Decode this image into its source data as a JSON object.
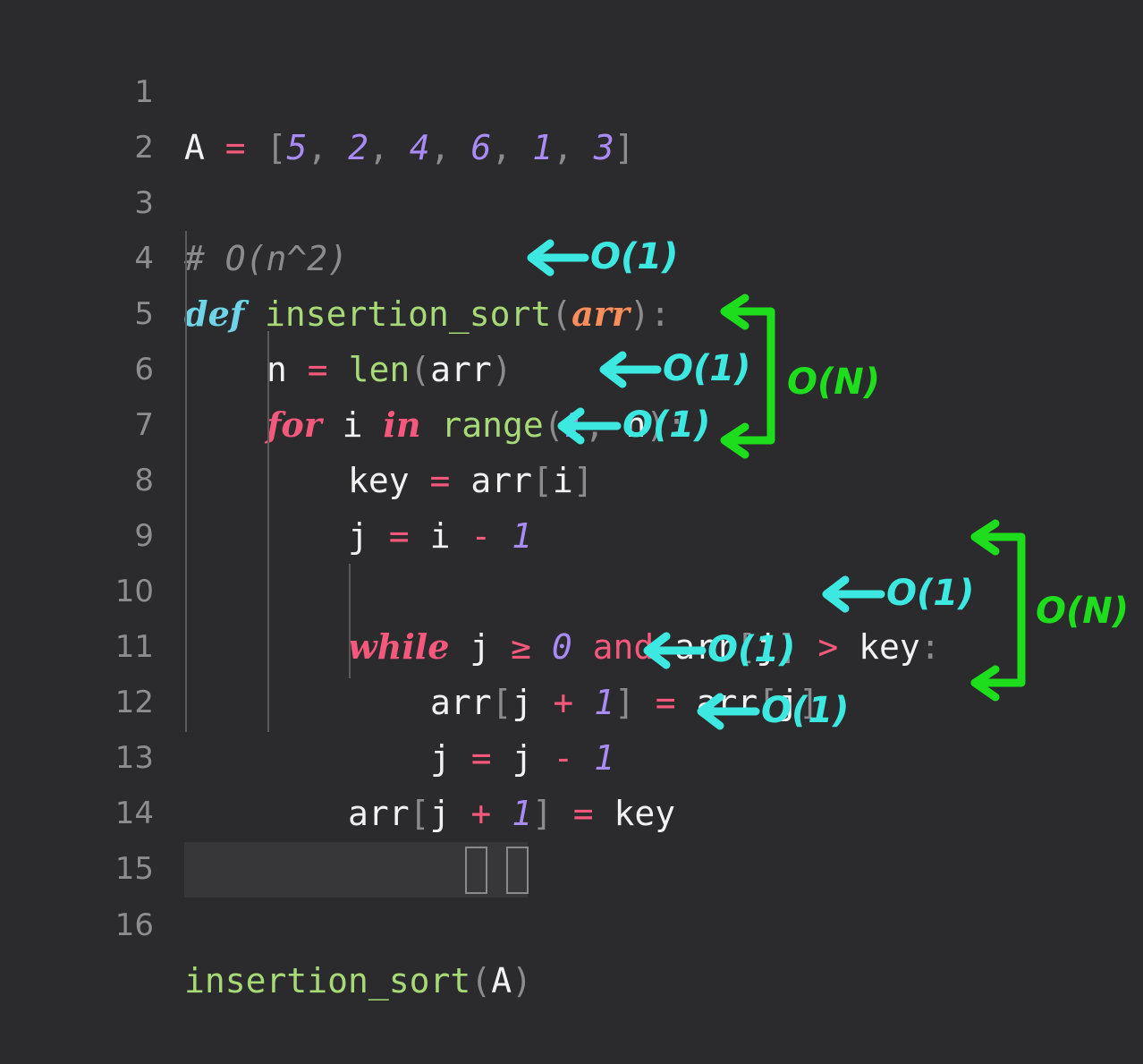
{
  "editor": {
    "theme": "dark",
    "background": "#2b2b2d",
    "gutter_color": "#8d8d8f",
    "active_line_background": "#37373a",
    "language": "python",
    "total_lines": 16
  },
  "line_numbers": [
    "1",
    "2",
    "3",
    "4",
    "5",
    "6",
    "7",
    "8",
    "9",
    "10",
    "11",
    "12",
    "13",
    "14",
    "15",
    "16"
  ],
  "code_lines": [
    {
      "number": "1",
      "indent": 0,
      "tokens": [
        {
          "text": "A",
          "kind": "var"
        },
        {
          "text": " ",
          "kind": "plain"
        },
        {
          "text": "=",
          "kind": "op"
        },
        {
          "text": " ",
          "kind": "plain"
        },
        {
          "text": "[",
          "kind": "punct"
        },
        {
          "text": "5",
          "kind": "num"
        },
        {
          "text": ",",
          "kind": "punct"
        },
        {
          "text": " ",
          "kind": "plain"
        },
        {
          "text": "2",
          "kind": "num"
        },
        {
          "text": ",",
          "kind": "punct"
        },
        {
          "text": " ",
          "kind": "plain"
        },
        {
          "text": "4",
          "kind": "num"
        },
        {
          "text": ",",
          "kind": "punct"
        },
        {
          "text": " ",
          "kind": "plain"
        },
        {
          "text": "6",
          "kind": "num"
        },
        {
          "text": ",",
          "kind": "punct"
        },
        {
          "text": " ",
          "kind": "plain"
        },
        {
          "text": "1",
          "kind": "num"
        },
        {
          "text": ",",
          "kind": "punct"
        },
        {
          "text": " ",
          "kind": "plain"
        },
        {
          "text": "3",
          "kind": "num"
        },
        {
          "text": "]",
          "kind": "punct"
        }
      ],
      "plain": "A = [5, 2, 4, 6, 1, 3]"
    },
    {
      "number": "2",
      "indent": 0,
      "tokens": [],
      "plain": ""
    },
    {
      "number": "3",
      "indent": 0,
      "tokens": [
        {
          "text": "# O(n^2)",
          "kind": "comment"
        }
      ],
      "plain": "# O(n^2)"
    },
    {
      "number": "4",
      "indent": 0,
      "tokens": [
        {
          "text": "def",
          "kind": "def"
        },
        {
          "text": " ",
          "kind": "plain"
        },
        {
          "text": "insertion_sort",
          "kind": "fn"
        },
        {
          "text": "(",
          "kind": "punct"
        },
        {
          "text": "arr",
          "kind": "param"
        },
        {
          "text": ")",
          "kind": "punct"
        },
        {
          "text": ":",
          "kind": "punct"
        }
      ],
      "plain": "def insertion_sort(arr):"
    },
    {
      "number": "5",
      "indent": 1,
      "tokens": [
        {
          "text": "n",
          "kind": "var"
        },
        {
          "text": " ",
          "kind": "plain"
        },
        {
          "text": "=",
          "kind": "op"
        },
        {
          "text": " ",
          "kind": "plain"
        },
        {
          "text": "len",
          "kind": "builtin"
        },
        {
          "text": "(",
          "kind": "punct"
        },
        {
          "text": "arr",
          "kind": "var"
        },
        {
          "text": ")",
          "kind": "punct"
        }
      ],
      "plain": "    n = len(arr)"
    },
    {
      "number": "6",
      "indent": 1,
      "tokens": [
        {
          "text": "for",
          "kind": "kw"
        },
        {
          "text": " ",
          "kind": "plain"
        },
        {
          "text": "i",
          "kind": "var"
        },
        {
          "text": " ",
          "kind": "plain"
        },
        {
          "text": "in",
          "kind": "kw"
        },
        {
          "text": " ",
          "kind": "plain"
        },
        {
          "text": "range",
          "kind": "builtin"
        },
        {
          "text": "(",
          "kind": "punct"
        },
        {
          "text": "1",
          "kind": "num"
        },
        {
          "text": ",",
          "kind": "punct"
        },
        {
          "text": " ",
          "kind": "plain"
        },
        {
          "text": "n",
          "kind": "var"
        },
        {
          "text": ")",
          "kind": "punct"
        },
        {
          "text": ":",
          "kind": "punct"
        }
      ],
      "plain": "    for i in range(1, n):"
    },
    {
      "number": "7",
      "indent": 2,
      "tokens": [
        {
          "text": "key",
          "kind": "var"
        },
        {
          "text": " ",
          "kind": "plain"
        },
        {
          "text": "=",
          "kind": "op"
        },
        {
          "text": " ",
          "kind": "plain"
        },
        {
          "text": "arr",
          "kind": "var"
        },
        {
          "text": "[",
          "kind": "punct"
        },
        {
          "text": "i",
          "kind": "var"
        },
        {
          "text": "]",
          "kind": "punct"
        }
      ],
      "plain": "        key = arr[i]"
    },
    {
      "number": "8",
      "indent": 2,
      "tokens": [
        {
          "text": "j",
          "kind": "var"
        },
        {
          "text": " ",
          "kind": "plain"
        },
        {
          "text": "=",
          "kind": "op"
        },
        {
          "text": " ",
          "kind": "plain"
        },
        {
          "text": "i",
          "kind": "var"
        },
        {
          "text": " ",
          "kind": "plain"
        },
        {
          "text": "-",
          "kind": "op"
        },
        {
          "text": " ",
          "kind": "plain"
        },
        {
          "text": "1",
          "kind": "num"
        }
      ],
      "plain": "        j = i - 1"
    },
    {
      "number": "9",
      "indent": 0,
      "tokens": [],
      "plain": ""
    },
    {
      "number": "10",
      "indent": 2,
      "tokens": [
        {
          "text": "while",
          "kind": "kw"
        },
        {
          "text": " ",
          "kind": "plain"
        },
        {
          "text": "j",
          "kind": "var"
        },
        {
          "text": " ",
          "kind": "plain"
        },
        {
          "text": "≥",
          "kind": "op"
        },
        {
          "text": " ",
          "kind": "plain"
        },
        {
          "text": "0",
          "kind": "num"
        },
        {
          "text": " ",
          "kind": "plain"
        },
        {
          "text": "and",
          "kind": "kw-op"
        },
        {
          "text": " ",
          "kind": "plain"
        },
        {
          "text": "arr",
          "kind": "var"
        },
        {
          "text": "[",
          "kind": "punct"
        },
        {
          "text": "j",
          "kind": "var"
        },
        {
          "text": "]",
          "kind": "punct"
        },
        {
          "text": " ",
          "kind": "plain"
        },
        {
          "text": ">",
          "kind": "op"
        },
        {
          "text": " ",
          "kind": "plain"
        },
        {
          "text": "key",
          "kind": "var"
        },
        {
          "text": ":",
          "kind": "punct"
        }
      ],
      "plain": "        while j >= 0 and arr[j] > key:"
    },
    {
      "number": "11",
      "indent": 3,
      "tokens": [
        {
          "text": "arr",
          "kind": "var"
        },
        {
          "text": "[",
          "kind": "punct"
        },
        {
          "text": "j",
          "kind": "var"
        },
        {
          "text": " ",
          "kind": "plain"
        },
        {
          "text": "+",
          "kind": "op"
        },
        {
          "text": " ",
          "kind": "plain"
        },
        {
          "text": "1",
          "kind": "num"
        },
        {
          "text": "]",
          "kind": "punct"
        },
        {
          "text": " ",
          "kind": "plain"
        },
        {
          "text": "=",
          "kind": "op"
        },
        {
          "text": " ",
          "kind": "plain"
        },
        {
          "text": "arr",
          "kind": "var"
        },
        {
          "text": "[",
          "kind": "punct"
        },
        {
          "text": "j",
          "kind": "var"
        },
        {
          "text": "]",
          "kind": "punct"
        }
      ],
      "plain": "            arr[j + 1] = arr[j]"
    },
    {
      "number": "12",
      "indent": 3,
      "tokens": [
        {
          "text": "j",
          "kind": "var"
        },
        {
          "text": " ",
          "kind": "plain"
        },
        {
          "text": "=",
          "kind": "op"
        },
        {
          "text": " ",
          "kind": "plain"
        },
        {
          "text": "j",
          "kind": "var"
        },
        {
          "text": " ",
          "kind": "plain"
        },
        {
          "text": "-",
          "kind": "op"
        },
        {
          "text": " ",
          "kind": "plain"
        },
        {
          "text": "1",
          "kind": "num"
        }
      ],
      "plain": "            j = j - 1"
    },
    {
      "number": "13",
      "indent": 2,
      "tokens": [
        {
          "text": "arr",
          "kind": "var"
        },
        {
          "text": "[",
          "kind": "punct"
        },
        {
          "text": "j",
          "kind": "var"
        },
        {
          "text": " ",
          "kind": "plain"
        },
        {
          "text": "+",
          "kind": "op"
        },
        {
          "text": " ",
          "kind": "plain"
        },
        {
          "text": "1",
          "kind": "num"
        },
        {
          "text": "]",
          "kind": "punct"
        },
        {
          "text": " ",
          "kind": "plain"
        },
        {
          "text": "=",
          "kind": "op"
        },
        {
          "text": " ",
          "kind": "plain"
        },
        {
          "text": "key",
          "kind": "var"
        }
      ],
      "plain": "        arr[j + 1] = key"
    },
    {
      "number": "14",
      "indent": 0,
      "tokens": [],
      "plain": ""
    },
    {
      "number": "15",
      "indent": 0,
      "tokens": [],
      "plain": ""
    },
    {
      "number": "16",
      "indent": 0,
      "active": true,
      "tokens": [
        {
          "text": "insertion_sort",
          "kind": "fn"
        },
        {
          "text": "(",
          "kind": "punct"
        },
        {
          "text": "A",
          "kind": "var"
        },
        {
          "text": ")",
          "kind": "punct"
        }
      ],
      "plain": "insertion_sort(A)"
    }
  ],
  "annotations": {
    "color_cyan": "#3ce8e0",
    "color_green": "#1ddd1d",
    "complexity_marks": [
      {
        "id": "o1-line5",
        "label": "O(1)",
        "color": "cyan",
        "target_line": "5"
      },
      {
        "id": "o1-line7",
        "label": "O(1)",
        "color": "cyan",
        "target_line": "7"
      },
      {
        "id": "o1-line8",
        "label": "O(1)",
        "color": "cyan",
        "target_line": "8"
      },
      {
        "id": "o1-line11",
        "label": "O(1)",
        "color": "cyan",
        "target_line": "11"
      },
      {
        "id": "o1-line12",
        "label": "O(1)",
        "color": "cyan",
        "target_line": "12"
      },
      {
        "id": "o1-line13",
        "label": "O(1)",
        "color": "cyan",
        "target_line": "13"
      }
    ],
    "loop_brackets": [
      {
        "id": "on-for-loop",
        "label": "O(N)",
        "color": "green",
        "spans_lines": [
          "6",
          "8"
        ]
      },
      {
        "id": "on-while-loop",
        "label": "O(N)",
        "color": "green",
        "spans_lines": [
          "10",
          "12"
        ]
      }
    ],
    "overall_complexity_comment": "# O(n^2)"
  }
}
